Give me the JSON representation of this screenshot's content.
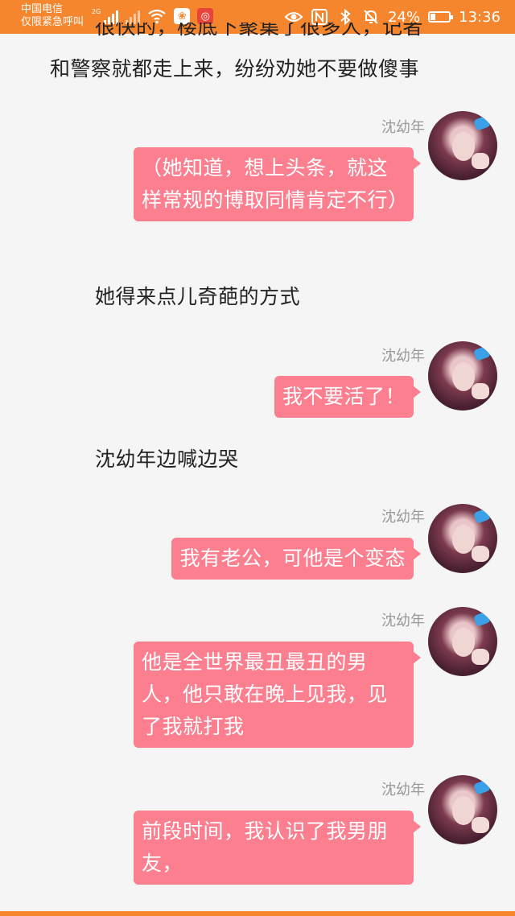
{
  "status_bar": {
    "carrier_line1": "中国电信",
    "carrier_line2": "仅限紧急呼叫",
    "network_label": "2G",
    "battery_percent": "24%",
    "battery_level": 0.24,
    "time": "13:36",
    "accent_color": "#f5862e",
    "icons": [
      "signal-icon",
      "no-signal-icon",
      "wifi-icon",
      "app-notification-icon",
      "weibo-icon",
      "eye-icon",
      "nfc-icon",
      "bluetooth-icon",
      "mute-icon",
      "battery-icon"
    ]
  },
  "chat": {
    "narration": [
      "很快的，楼底下聚集了很多人，记者",
      "和警察就都走上来，纷纷劝她不要做傻事",
      "她得来点儿奇葩的方式",
      "沈幼年边喊边哭"
    ],
    "messages": [
      {
        "sender": "沈幼年",
        "text": "（她知道，想上头条，就这样常规的博取同情肯定不行）"
      },
      {
        "sender": "沈幼年",
        "text": "我不要活了！"
      },
      {
        "sender": "沈幼年",
        "text": "我有老公，可他是个变态"
      },
      {
        "sender": "沈幼年",
        "text": "他是全世界最丑最丑的男人，他只敢在晚上见我，见了我就打我"
      },
      {
        "sender": "沈幼年",
        "text": "前段时间，我认识了我男朋友，"
      }
    ],
    "bubble_color": "#fb7f8f"
  }
}
